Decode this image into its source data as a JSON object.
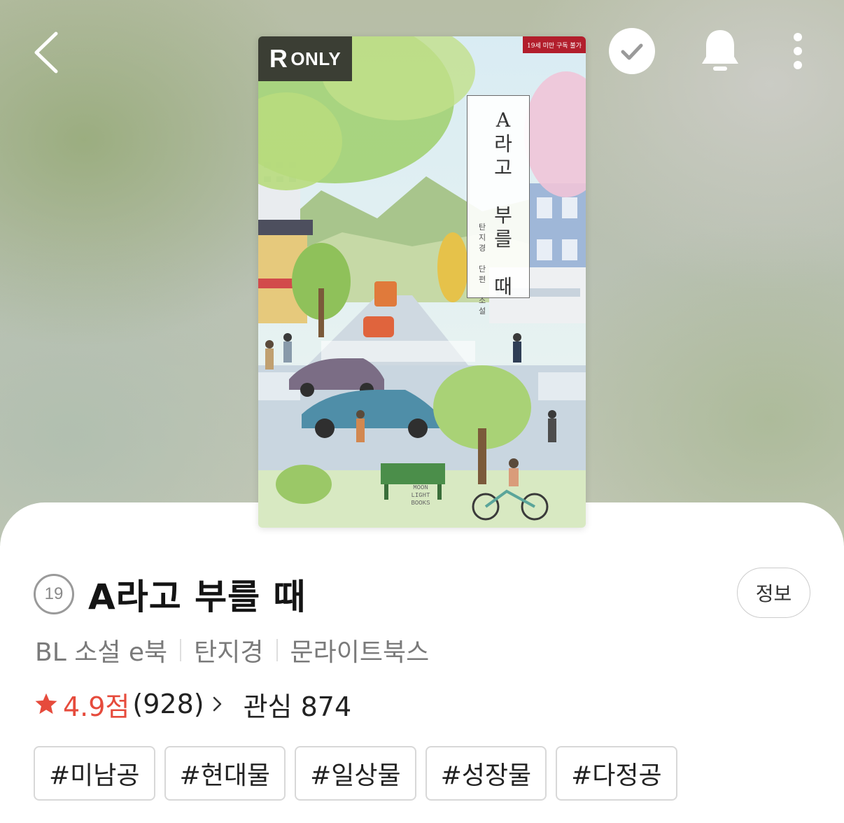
{
  "topbar": {
    "back_icon": "chevron-left-icon",
    "check_icon": "check-circle-icon",
    "bell_icon": "bell-icon",
    "more_icon": "more-vertical-icon"
  },
  "cover": {
    "badge_r": "R",
    "badge_only": "ONLY",
    "age_notice": "19세 미만 구독 불가",
    "title": "A라고 부를 때",
    "title_vertical": "A\n라\n고\n \n부\n를\n \n때",
    "author_line": "탄지경 단편 소설",
    "author_vertical": "탄\n지\n경\n \n단\n편\n \n소\n설",
    "publisher_logo": "MOON\nLIGHT\nBOOKS"
  },
  "book": {
    "age_badge": "19",
    "title": "A라고 부를 때",
    "info_button": "정보",
    "category": "BL 소설 e북",
    "author": "탄지경",
    "publisher": "문라이트북스",
    "rating": "4.9점",
    "rating_count": "(928)",
    "interest": "관심 874",
    "colors": {
      "accent": "#e64b3c",
      "muted": "#7a7a7a"
    }
  },
  "tags": [
    "#미남공",
    "#현대물",
    "#일상물",
    "#성장물",
    "#다정공"
  ]
}
